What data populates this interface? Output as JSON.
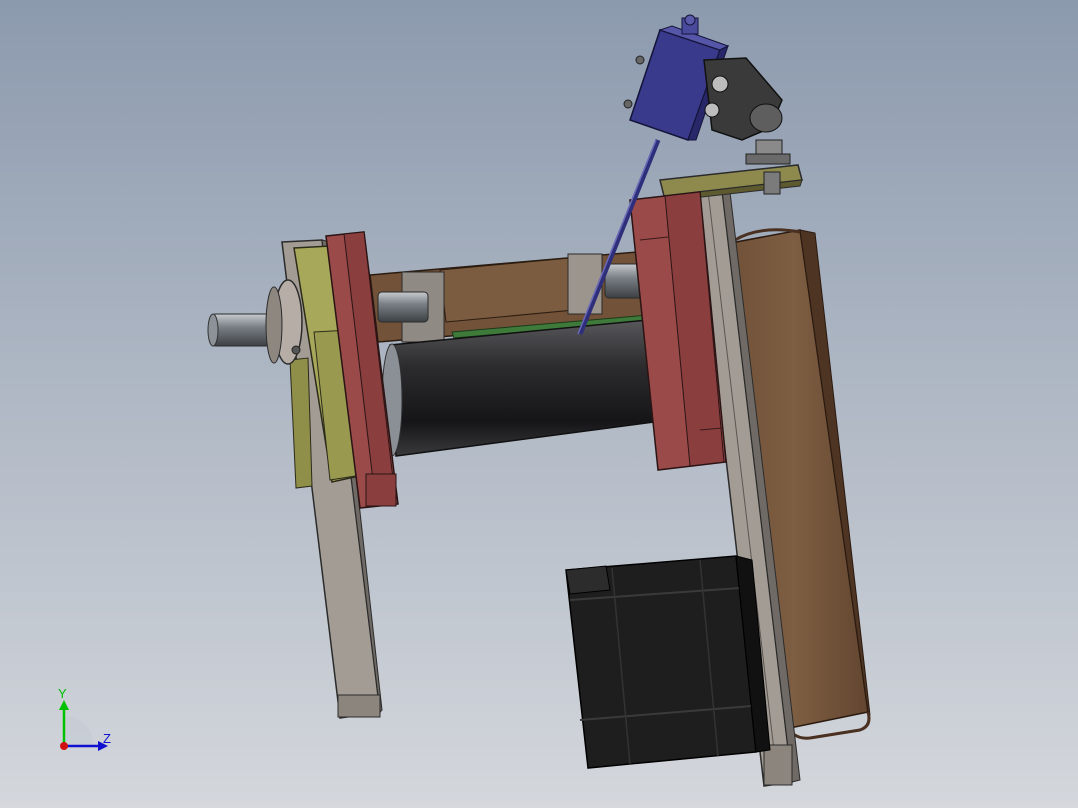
{
  "viewport": {
    "background_top": "#8c9aae",
    "background_bottom": "#d4d7dc"
  },
  "triad": {
    "y_label": "Y",
    "z_label": "Z",
    "y_color": "#00c000",
    "z_color": "#1010d0",
    "x_color": "#d01010"
  },
  "colors": {
    "end_plate": "#9b4a4a",
    "frame_gray": "#9a938d",
    "brown_housing": "#7a5a40",
    "olive_bracket": "#a8a85a",
    "roller": "#2a2a2c",
    "motor": "#1e1e1e",
    "sensor_blue": "#3a3a8c",
    "clamp_dark": "#3a3a3a"
  }
}
